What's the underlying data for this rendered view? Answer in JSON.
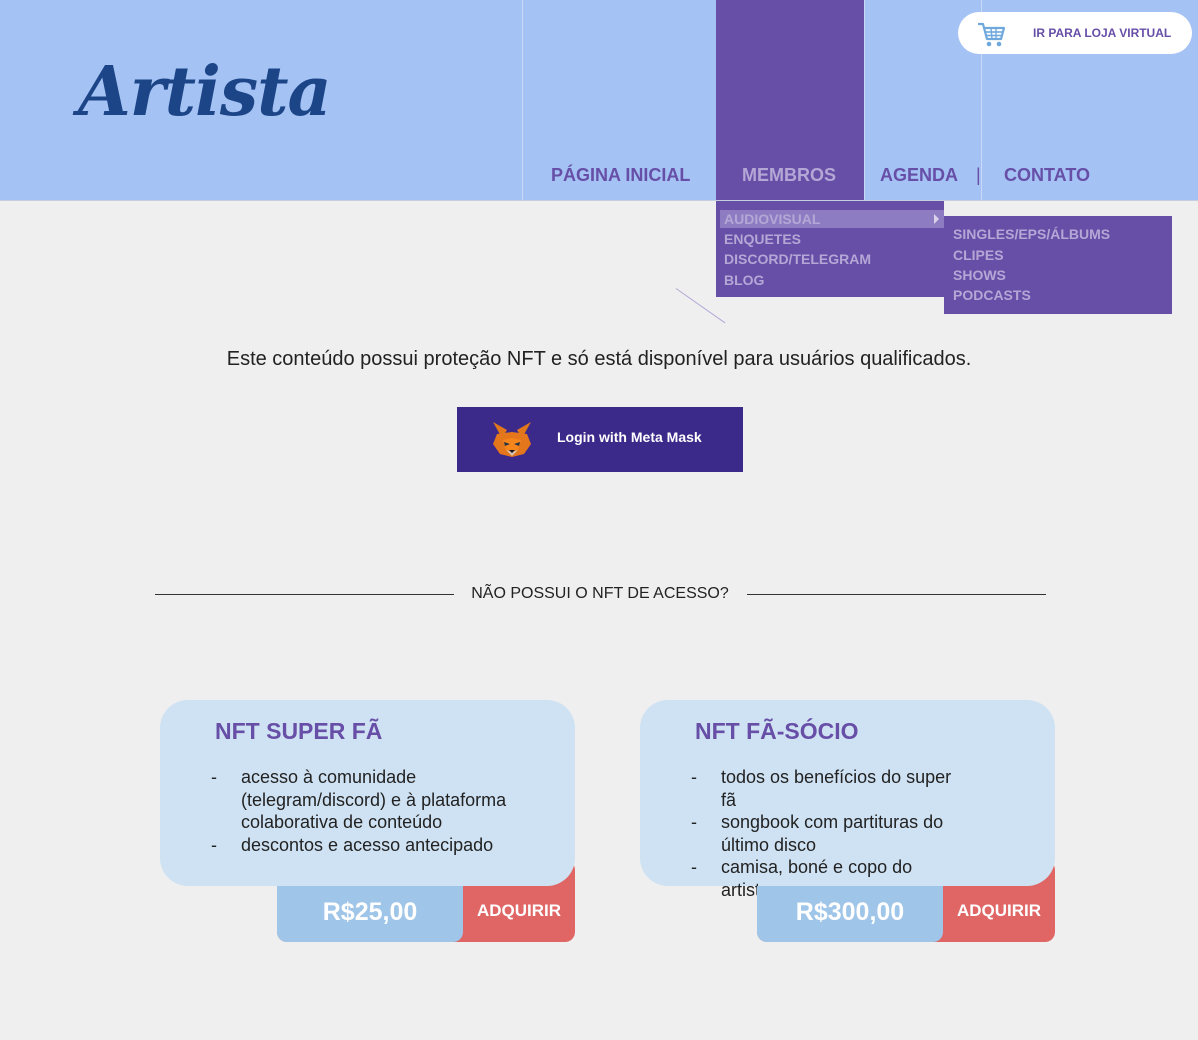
{
  "header": {
    "logo": "Artista",
    "store_button": "IR PARA LOJA VIRTUAL"
  },
  "nav": {
    "items": [
      "PÁGINA INICIAL",
      "MEMBROS",
      "AGENDA",
      "CONTATO"
    ],
    "separator": "|",
    "active": "MEMBROS"
  },
  "dropdown": {
    "items": [
      "AUDIOVISUAL",
      "ENQUETES",
      "DISCORD/TELEGRAM",
      "BLOG"
    ],
    "highlighted": "AUDIOVISUAL"
  },
  "submenu": {
    "items": [
      "SINGLES/EPS/ÁLBUMS",
      "CLIPES",
      "SHOWS",
      "PODCASTS"
    ]
  },
  "main": {
    "notice": "Este conteúdo possui proteção NFT e só está disponível para usuários qualificados.",
    "login_button": "Login with Meta Mask",
    "divider_text": "NÃO POSSUI O NFT DE ACESSO?"
  },
  "plans": [
    {
      "title": "NFT SUPER FÃ",
      "benefits": [
        "acesso à comunidade (telegram/discord) e à plataforma colaborativa de conteúdo",
        "descontos e acesso antecipado"
      ],
      "price": "R$25,00",
      "buy_label": "ADQUIRIR"
    },
    {
      "title": "NFT FÃ-SÓCIO",
      "benefits": [
        "todos os benefícios do super fã",
        "songbook com partituras do último disco",
        "camisa, boné e copo do artista"
      ],
      "price": "R$300,00",
      "buy_label": "ADQUIRIR"
    }
  ],
  "colors": {
    "header_bg": "#a4c2f4",
    "accent_purple": "#674ea7",
    "menu_text": "#b4a7d6",
    "card_bg": "#cfe2f3",
    "price_bg": "#9fc5e8",
    "buy_bg": "#e06666",
    "metamask_bg": "#3c2a8a",
    "logo": "#1c4587"
  },
  "icons": {
    "cart": "shopping-cart-icon",
    "fox": "metamask-fox-icon",
    "submenu_arrow": "caret-right-icon"
  }
}
